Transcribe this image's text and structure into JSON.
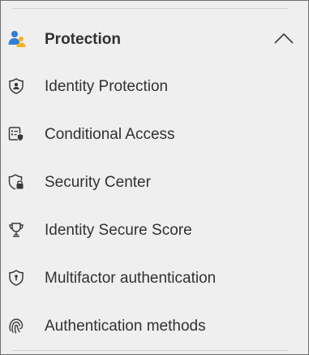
{
  "section": {
    "title": "Protection",
    "icon": "users-group-icon",
    "expanded": true,
    "colors": {
      "person_blue": "#2f7fd6",
      "person_yellow": "#f2b320",
      "icon_stroke": "#3b3a39",
      "text": "#323130",
      "background": "#efefef"
    }
  },
  "items": [
    {
      "label": "Identity Protection",
      "icon": "shield-person-icon"
    },
    {
      "label": "Conditional Access",
      "icon": "clipboard-shield-icon"
    },
    {
      "label": "Security Center",
      "icon": "shield-lock-icon"
    },
    {
      "label": "Identity Secure Score",
      "icon": "trophy-icon"
    },
    {
      "label": "Multifactor authentication",
      "icon": "shield-keyhole-icon"
    },
    {
      "label": "Authentication methods",
      "icon": "fingerprint-icon"
    }
  ]
}
